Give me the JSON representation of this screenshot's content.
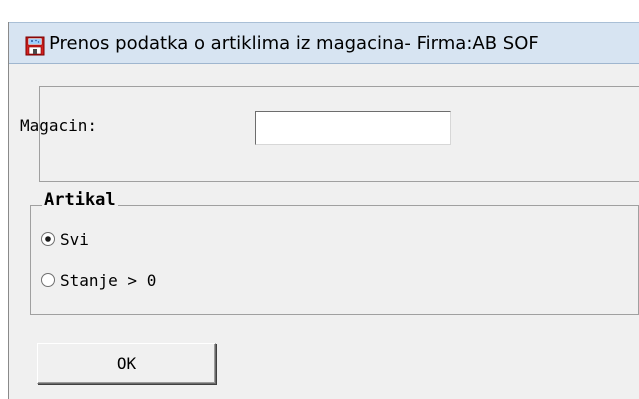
{
  "window": {
    "title": "Prenos podatka o artiklima iz magacina- Firma:AB SOF"
  },
  "form": {
    "magacin_label": "Magacin:",
    "magacin_value": ""
  },
  "group": {
    "title": "Artikal",
    "options": [
      {
        "label": "Svi",
        "selected": true
      },
      {
        "label": "Stanje > 0",
        "selected": false
      }
    ]
  },
  "actions": {
    "ok_label": "OK"
  }
}
